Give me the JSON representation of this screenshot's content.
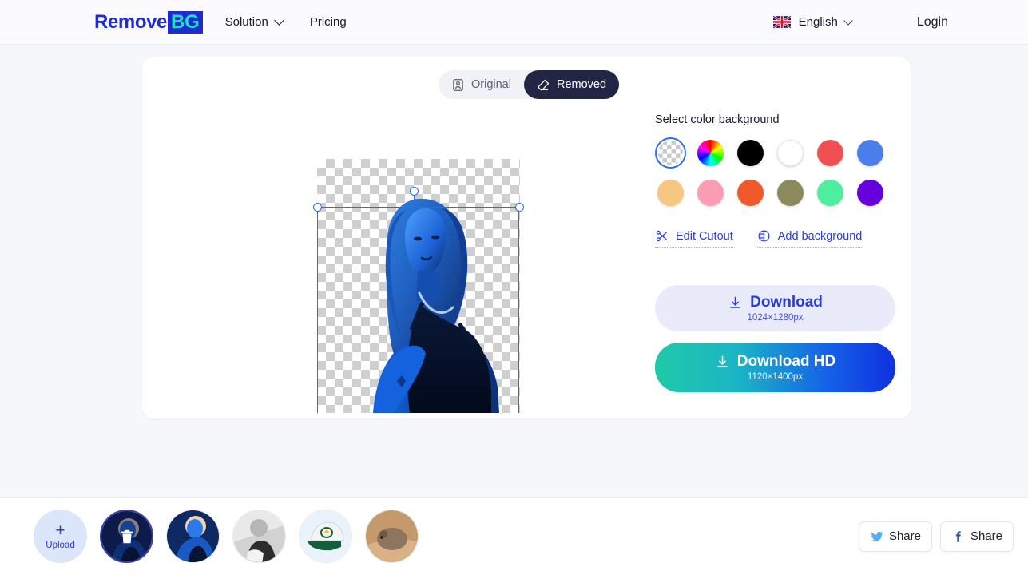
{
  "header": {
    "logo_primary": "Remove",
    "logo_accent": "BG",
    "nav": [
      {
        "label": "Solution",
        "has_dropdown": true
      },
      {
        "label": "Pricing",
        "has_dropdown": false
      }
    ],
    "language": "English",
    "login": "Login"
  },
  "editor": {
    "toggle": [
      {
        "label": "Original",
        "icon": "portrait-frame-icon",
        "active": false
      },
      {
        "label": "Removed",
        "icon": "eraser-icon",
        "active": true
      }
    ],
    "panel_title": "Select color background",
    "swatches": [
      {
        "name": "transparent",
        "color": "transparent",
        "selected": true
      },
      {
        "name": "color-picker-wheel",
        "color": "wheel",
        "selected": false
      },
      {
        "name": "black",
        "color": "#000000",
        "selected": false
      },
      {
        "name": "white",
        "color": "#ffffff",
        "selected": false
      },
      {
        "name": "red",
        "color": "#f05050",
        "selected": false
      },
      {
        "name": "blue",
        "color": "#4a7feb",
        "selected": false
      },
      {
        "name": "tan",
        "color": "#f5c781",
        "selected": false
      },
      {
        "name": "pink",
        "color": "#fb9cb5",
        "selected": false
      },
      {
        "name": "orange",
        "color": "#f05a2a",
        "selected": false
      },
      {
        "name": "olive",
        "color": "#8c8a5c",
        "selected": false
      },
      {
        "name": "mint",
        "color": "#4dee9e",
        "selected": false
      },
      {
        "name": "purple",
        "color": "#6600dd",
        "selected": false
      }
    ],
    "links": [
      {
        "label": "Edit Cutout",
        "icon": "scissors-icon"
      },
      {
        "label": "Add background",
        "icon": "globe-image-icon"
      }
    ],
    "download": {
      "label": "Download",
      "size": "1024×1280px",
      "icon": "download-icon"
    },
    "download_hd": {
      "label": "Download HD",
      "size": "1120×1400px",
      "icon": "download-icon"
    },
    "accent_color": "#2a3cd6",
    "hd_gradient_from": "#20c9a8",
    "hd_gradient_to": "#1030e0"
  },
  "bottom": {
    "upload": {
      "plus": "+",
      "label": "Upload"
    },
    "thumbnails": [
      {
        "name": "thumb-blue-portrait-selected",
        "selected": true,
        "overlay_icon": "trash-icon"
      },
      {
        "name": "thumb-blue-portrait",
        "selected": false,
        "overlay_icon": ""
      },
      {
        "name": "thumb-bw-portrait",
        "selected": false,
        "overlay_icon": ""
      },
      {
        "name": "thumb-green-cap",
        "selected": false,
        "overlay_icon": ""
      },
      {
        "name": "thumb-hamster",
        "selected": false,
        "overlay_icon": ""
      }
    ],
    "share": [
      {
        "label": "Share",
        "icon": "twitter-icon",
        "color": "#55acee"
      },
      {
        "label": "Share",
        "icon": "facebook-icon",
        "color": "#3b5998"
      }
    ]
  }
}
